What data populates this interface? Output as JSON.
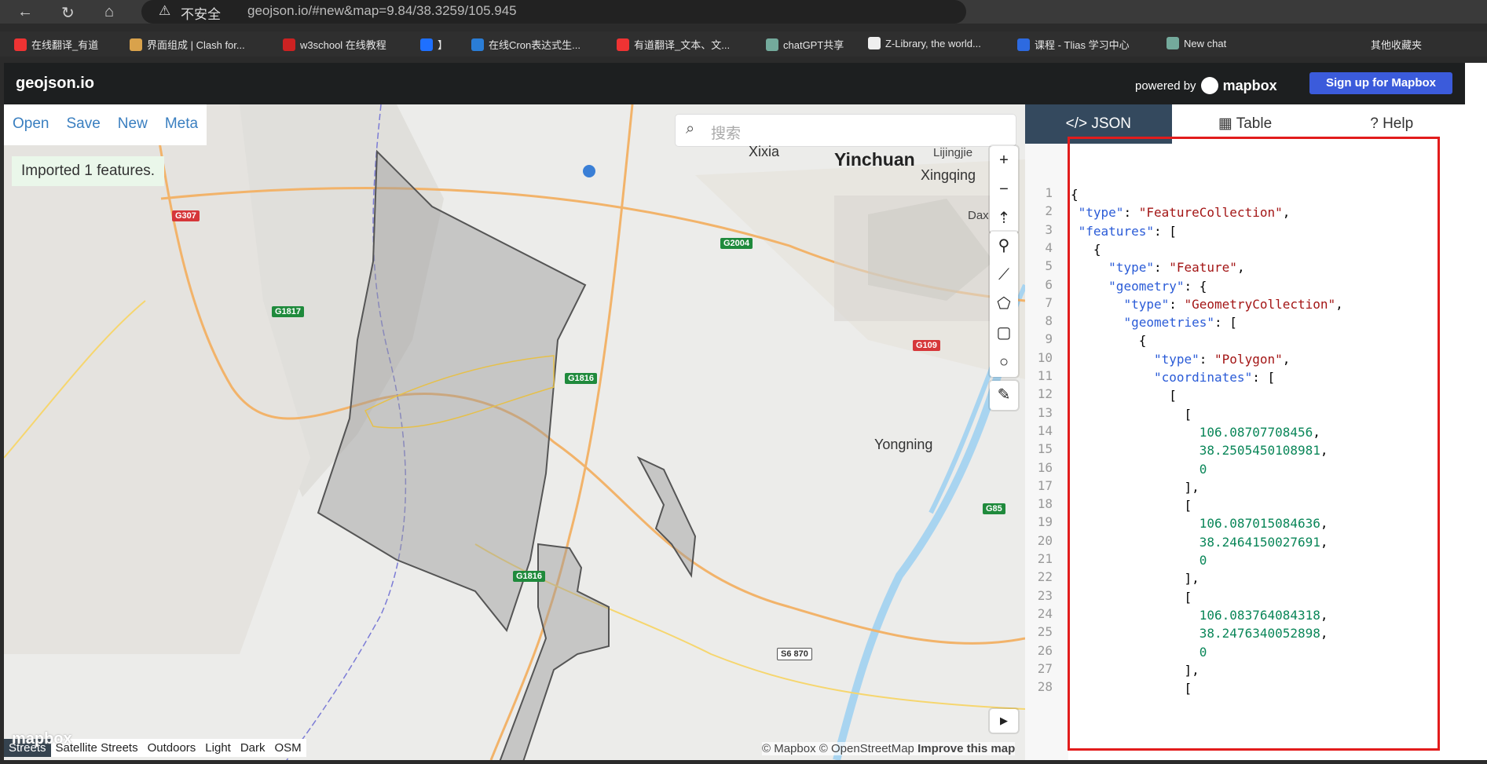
{
  "browser": {
    "insecure": "不安全",
    "url": "geojson.io/#new&map=9.84/38.3259/105.945"
  },
  "bookmarks": [
    {
      "label": "在线翻译_有道",
      "color": "#e33"
    },
    {
      "label": "界面组成 | Clash for...",
      "color": "#d9a24b"
    },
    {
      "label": "w3school 在线教程",
      "color": "#c22"
    },
    {
      "label": "】",
      "color": "#1e70ff"
    },
    {
      "label": "在线Cron表达式生...",
      "color": "#2a7dd6"
    },
    {
      "label": "有道翻译_文本、文...",
      "color": "#e33"
    },
    {
      "label": "chatGPT共享",
      "color": "#74aa9c"
    },
    {
      "label": "Z-Library, the world...",
      "color": "#eee"
    },
    {
      "label": "课程 - Tlias 学习中心",
      "color": "#2d6ae0"
    },
    {
      "label": "New chat",
      "color": "#74aa9c"
    }
  ],
  "bookmark_other": "其他收藏夹",
  "app": {
    "logo": "geojson.io",
    "powered": "powered by",
    "mapbox": "mapbox",
    "signup": "Sign up for Mapbox"
  },
  "nav": [
    "Open",
    "Save",
    "New",
    "Meta"
  ],
  "import_msg": "Imported 1 features.",
  "search": {
    "placeholder": "搜索"
  },
  "map_labels": {
    "xixia": "Xixia",
    "yinchuan": "Yinchuan",
    "lijingjie": "Lijingjie",
    "xingqing": "Xingqing",
    "dax": "Dax",
    "yongning": "Yongning"
  },
  "shields": {
    "g307": "G307",
    "g2004": "G2004",
    "g1817": "G1817",
    "g1816a": "G1816",
    "g109": "G109",
    "g85": "G85",
    "g1816b": "G1816",
    "s870": "S6 870"
  },
  "layers": [
    "Streets",
    "Satellite Streets",
    "Outdoors",
    "Light",
    "Dark",
    "OSM"
  ],
  "attribution": {
    "mapbox": "© Mapbox",
    "osm": "© OpenStreetMap",
    "improve": "Improve this map"
  },
  "mapbox_logo": "mapbox",
  "tabs": [
    "JSON",
    "Table",
    "Help"
  ],
  "json_lines": [
    [
      "{"
    ],
    [
      " ",
      "\"type\"",
      ": ",
      "\"FeatureCollection\"",
      ","
    ],
    [
      " ",
      "\"features\"",
      ": ["
    ],
    [
      "   {"
    ],
    [
      "     ",
      "\"type\"",
      ": ",
      "\"Feature\"",
      ","
    ],
    [
      "     ",
      "\"geometry\"",
      ": {"
    ],
    [
      "       ",
      "\"type\"",
      ": ",
      "\"GeometryCollection\"",
      ","
    ],
    [
      "       ",
      "\"geometries\"",
      ": ["
    ],
    [
      "         {"
    ],
    [
      "           ",
      "\"type\"",
      ": ",
      "\"Polygon\"",
      ","
    ],
    [
      "           ",
      "\"coordinates\"",
      ": ["
    ],
    [
      "             ["
    ],
    [
      "               ["
    ],
    [
      "                 ",
      "106.08707708456",
      ","
    ],
    [
      "                 ",
      "38.2505450108981",
      ","
    ],
    [
      "                 ",
      "0"
    ],
    [
      "               ],"
    ],
    [
      "               ["
    ],
    [
      "                 ",
      "106.087015084636",
      ","
    ],
    [
      "                 ",
      "38.2464150027691",
      ","
    ],
    [
      "                 ",
      "0"
    ],
    [
      "               ],"
    ],
    [
      "               ["
    ],
    [
      "                 ",
      "106.083764084318",
      ","
    ],
    [
      "                 ",
      "38.2476340052898",
      ","
    ],
    [
      "                 ",
      "0"
    ],
    [
      "               ],"
    ],
    [
      "               ["
    ]
  ]
}
